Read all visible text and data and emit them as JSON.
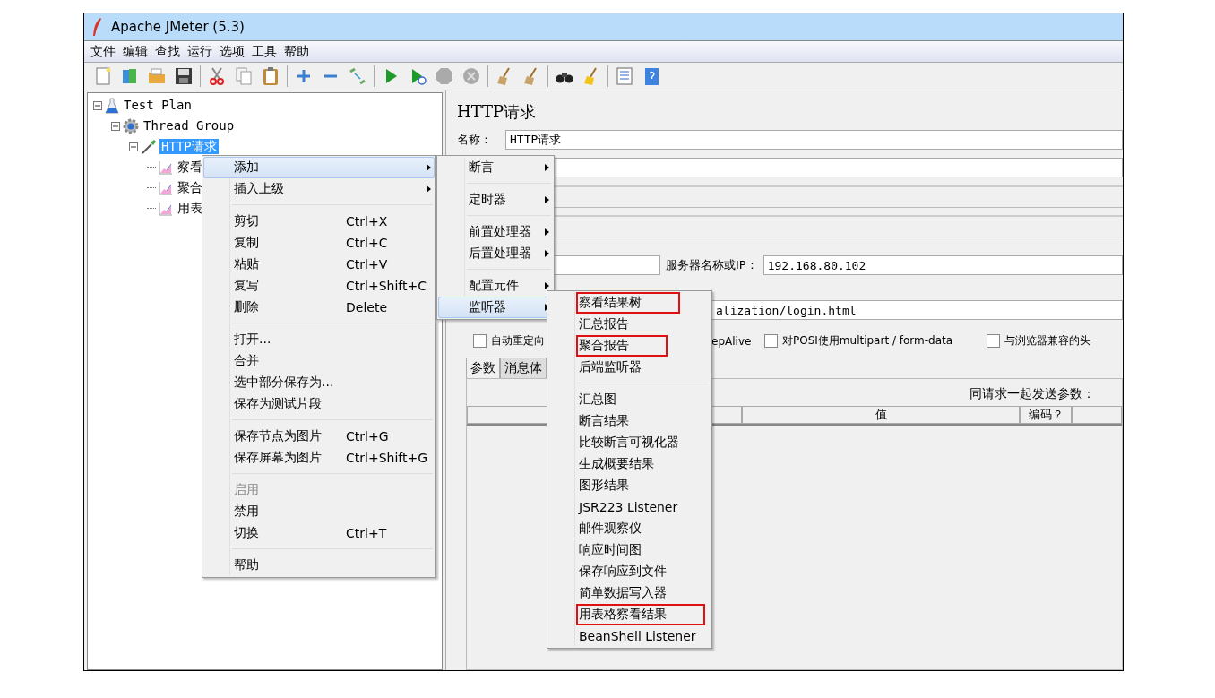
{
  "window": {
    "title": "Apache JMeter (5.3)"
  },
  "menubar": [
    "文件",
    "编辑",
    "查找",
    "运行",
    "选项",
    "工具",
    "帮助"
  ],
  "tree": [
    {
      "label": "Test Plan",
      "expanded": true,
      "selected": false,
      "children": [
        {
          "label": "Thread Group",
          "expanded": true,
          "selected": false,
          "children": [
            {
              "label": "HTTP请求",
              "expanded": true,
              "selected": true,
              "children": [
                {
                  "label": "察看",
                  "selected": false
                },
                {
                  "label": "聚合",
                  "selected": false
                },
                {
                  "label": "用表",
                  "selected": false
                }
              ]
            }
          ]
        }
      ]
    }
  ],
  "editor": {
    "title": "HTTP请求",
    "name_label": "名称：",
    "name_value": "HTTP请求",
    "server_label": "服务器名称或IP：",
    "server_value": "192.168.80.102",
    "path_value": "alization/login.html",
    "checkboxes": [
      {
        "kind": "checkbox",
        "label": "自动重定向",
        "checked": false
      },
      {
        "kind": "label",
        "label": "epAlive"
      },
      {
        "kind": "checkbox",
        "label": "对POSI使用multipart / form-data",
        "checked": false
      },
      {
        "kind": "checkbox",
        "label": "与浏览器兼容的头",
        "checked": false
      }
    ],
    "tabs": [
      {
        "label": "参数",
        "selected": true
      },
      {
        "label": "消息体",
        "selected": false
      }
    ],
    "table_caption": "同请求一起发送参数：",
    "columns": [
      "值",
      "编码？"
    ]
  },
  "context_menu": [
    {
      "kind": "item",
      "label": "添加",
      "submenu": true,
      "selected": true
    },
    {
      "kind": "item",
      "label": "插入上级",
      "submenu": true,
      "selected": false
    },
    {
      "kind": "separator"
    },
    {
      "kind": "item",
      "label": "剪切",
      "shortcut": "Ctrl+X",
      "selected": false
    },
    {
      "kind": "item",
      "label": "复制",
      "shortcut": "Ctrl+C",
      "selected": false
    },
    {
      "kind": "item",
      "label": "粘贴",
      "shortcut": "Ctrl+V",
      "selected": false
    },
    {
      "kind": "item",
      "label": "复写",
      "shortcut": "Ctrl+Shift+C",
      "selected": false
    },
    {
      "kind": "item",
      "label": "删除",
      "shortcut": "Delete",
      "selected": false
    },
    {
      "kind": "separator"
    },
    {
      "kind": "item",
      "label": "打开...",
      "selected": false
    },
    {
      "kind": "item",
      "label": "合并",
      "selected": false
    },
    {
      "kind": "item",
      "label": "选中部分保存为...",
      "selected": false
    },
    {
      "kind": "item",
      "label": "保存为测试片段",
      "selected": false
    },
    {
      "kind": "separator"
    },
    {
      "kind": "item",
      "label": "保存节点为图片",
      "shortcut": "Ctrl+G",
      "selected": false
    },
    {
      "kind": "item",
      "label": "保存屏幕为图片",
      "shortcut": "Ctrl+Shift+G",
      "selected": false
    },
    {
      "kind": "separator"
    },
    {
      "kind": "item",
      "label": "启用",
      "disabled": true,
      "selected": false
    },
    {
      "kind": "item",
      "label": "禁用",
      "selected": false
    },
    {
      "kind": "item",
      "label": "切换",
      "shortcut": "Ctrl+T",
      "selected": false
    },
    {
      "kind": "separator"
    },
    {
      "kind": "item",
      "label": "帮助",
      "selected": false
    }
  ],
  "add_submenu": [
    {
      "kind": "item",
      "label": "断言",
      "submenu": true,
      "selected": false
    },
    {
      "kind": "separator"
    },
    {
      "kind": "item",
      "label": "定时器",
      "submenu": true,
      "selected": false
    },
    {
      "kind": "separator"
    },
    {
      "kind": "item",
      "label": "前置处理器",
      "submenu": true,
      "selected": false
    },
    {
      "kind": "item",
      "label": "后置处理器",
      "submenu": true,
      "selected": false
    },
    {
      "kind": "separator"
    },
    {
      "kind": "item",
      "label": "配置元件",
      "submenu": true,
      "selected": false
    },
    {
      "kind": "item",
      "label": "监听器",
      "submenu": true,
      "selected": true
    }
  ],
  "listener_submenu": [
    {
      "kind": "item",
      "label": "察看结果树",
      "highlighted": true
    },
    {
      "kind": "item",
      "label": "汇总报告",
      "highlighted": false
    },
    {
      "kind": "item",
      "label": "聚合报告",
      "highlighted": true
    },
    {
      "kind": "item",
      "label": "后端监听器",
      "highlighted": false
    },
    {
      "kind": "separator"
    },
    {
      "kind": "item",
      "label": "汇总图",
      "highlighted": false
    },
    {
      "kind": "item",
      "label": "断言结果",
      "highlighted": false
    },
    {
      "kind": "item",
      "label": "比较断言可视化器",
      "highlighted": false
    },
    {
      "kind": "item",
      "label": "生成概要结果",
      "highlighted": false
    },
    {
      "kind": "item",
      "label": "图形结果",
      "highlighted": false
    },
    {
      "kind": "item",
      "label": "JSR223 Listener",
      "highlighted": false
    },
    {
      "kind": "item",
      "label": "邮件观察仪",
      "highlighted": false
    },
    {
      "kind": "item",
      "label": "响应时间图",
      "highlighted": false
    },
    {
      "kind": "item",
      "label": "保存响应到文件",
      "highlighted": false
    },
    {
      "kind": "item",
      "label": "简单数据写入器",
      "highlighted": false
    },
    {
      "kind": "item",
      "label": "用表格察看结果",
      "highlighted": true
    },
    {
      "kind": "item",
      "label": "BeanShell Listener",
      "highlighted": false
    }
  ]
}
